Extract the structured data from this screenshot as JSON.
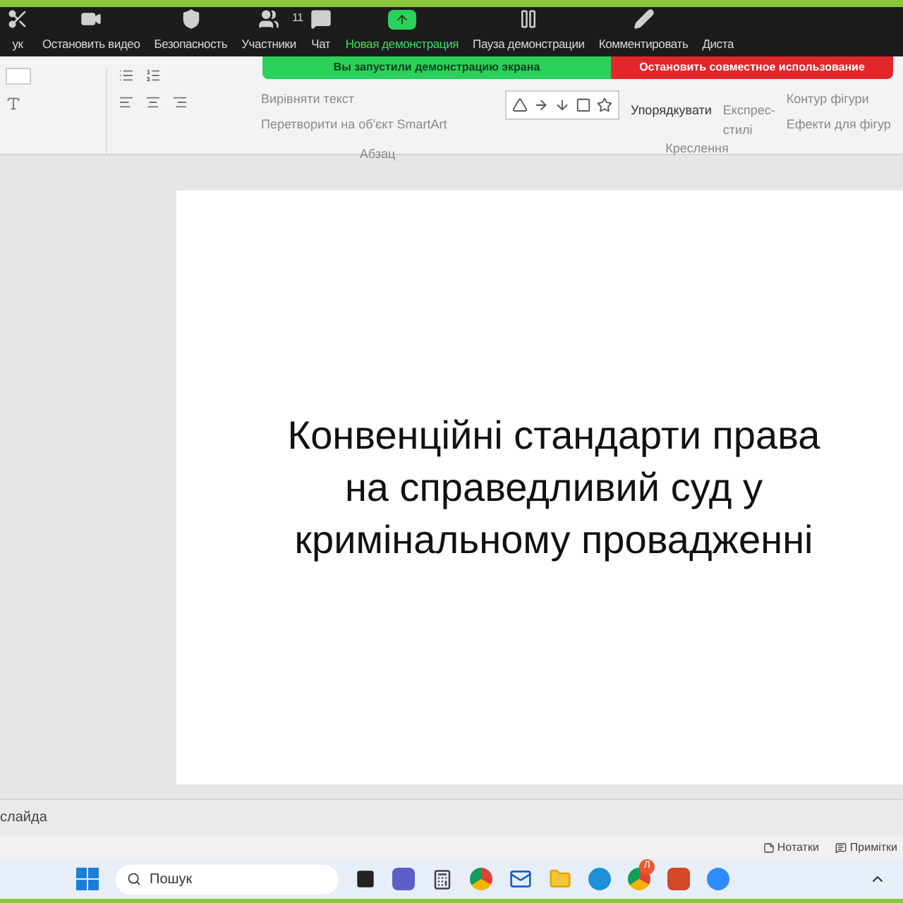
{
  "zoom_toolbar": {
    "items": [
      {
        "label": "ук",
        "kind": "cut",
        "selected": false
      },
      {
        "label": "Остановить видео",
        "kind": "video",
        "selected": false
      },
      {
        "label": "Безопасность",
        "kind": "shield",
        "selected": false
      },
      {
        "label": "Участники",
        "kind": "people",
        "selected": false,
        "badge": "11"
      },
      {
        "label": "Чат",
        "kind": "chat",
        "selected": false
      },
      {
        "label": "Новая демонстрация",
        "kind": "share",
        "selected": true
      },
      {
        "label": "Пауза демонстрации",
        "kind": "pause",
        "selected": false
      },
      {
        "label": "Комментировать",
        "kind": "pen",
        "selected": false
      },
      {
        "label": "Диста",
        "kind": "none",
        "selected": false
      }
    ]
  },
  "share_banner": {
    "message": "Вы запустили демонстрацию экрана",
    "stop_button": "Остановить совместное использование"
  },
  "ribbon": {
    "paragraph": {
      "align_text": "Вирівняти текст",
      "smartart": "Перетворити на об'єкт SmartArt",
      "group_label": "Абзац"
    },
    "drawing": {
      "arrange": "Упорядкувати",
      "quick_styles": "Експрес-стилі",
      "outline": "Контур фігури",
      "effects": "Ефекти для фігур",
      "group_label": "Креслення"
    }
  },
  "slide": {
    "title_lines": [
      "Конвенційні стандарти права",
      "на справедливий суд у",
      "кримінальному провадженні"
    ]
  },
  "status_bar": {
    "slide_info": "слайда",
    "notes": "Нотатки",
    "comments": "Примітки"
  },
  "taskbar": {
    "search_placeholder": "Пошук",
    "chrome_badge": "Л"
  }
}
